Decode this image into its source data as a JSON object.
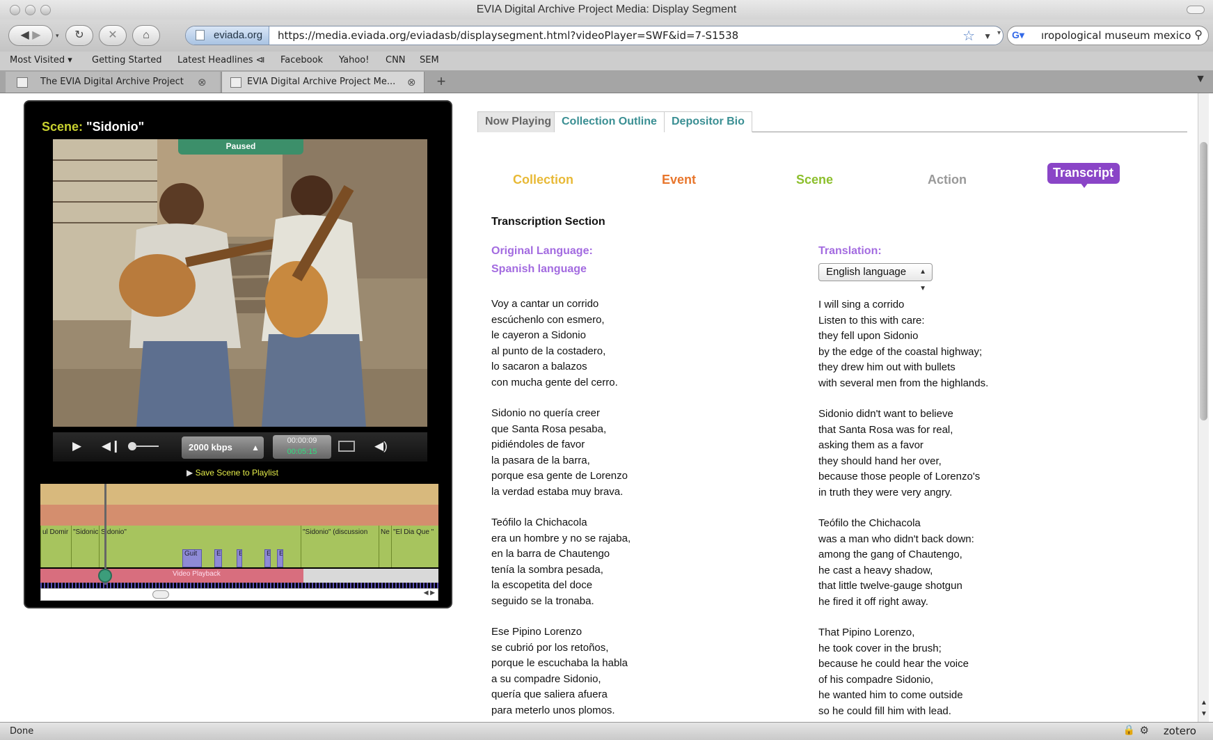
{
  "window": {
    "title": "EVIA Digital Archive Project Media: Display Segment"
  },
  "navbar": {
    "url_domain": "eviada.org",
    "url": "https://media.eviada.org/eviadasb/displaysegment.html?videoPlayer=SWF&id=7-S1538",
    "search_text": "ıropological museum mexico"
  },
  "bookmarks": {
    "items": [
      "Most Visited ▾",
      "Getting Started",
      "Latest Headlines ⧏",
      "Facebook",
      "Yahoo!",
      "CNN",
      "SEM"
    ]
  },
  "tabs": [
    {
      "label": "The EVIA Digital Archive Project",
      "active": false
    },
    {
      "label": "EVIA Digital Archive Project Me...",
      "active": true
    }
  ],
  "player": {
    "scene_key": "Scene:",
    "scene_value": "\"Sidonio\"",
    "state": "Paused",
    "bitrate": "2000 kbps",
    "time_current": "00:00:09",
    "time_total": "00:05:15",
    "volume_level": 0.0,
    "save_scene_label": "Save Scene to Playlist",
    "timeline": {
      "segments": [
        {
          "label": "ul Domir"
        },
        {
          "label": "\"Sidonic"
        },
        {
          "label": "Sidonio\""
        },
        {
          "label": "\"Sidonio\" (discussion"
        },
        {
          "label": "Ne"
        },
        {
          "label": "\"El Dia Que \""
        }
      ],
      "actions": [
        {
          "label": "Guit"
        },
        {
          "label": "E"
        },
        {
          "label": "E"
        },
        {
          "label": "E"
        },
        {
          "label": "E"
        }
      ],
      "playback_label": "Video Playback",
      "playback_progress": 0.66
    }
  },
  "page_tabs": {
    "now_playing": "Now Playing",
    "collection_outline": "Collection Outline",
    "depositor_bio": "Depositor Bio"
  },
  "categories": {
    "collection": "Collection",
    "event": "Event",
    "scene": "Scene",
    "action": "Action",
    "transcript": "Transcript",
    "colors": {
      "collection": "#e8b936",
      "event": "#e8762c",
      "scene": "#8cbf2c",
      "action": "#999999",
      "transcript": "#8a45c7"
    }
  },
  "transcript": {
    "section_title": "Transcription Section",
    "original_label": "Original Language:",
    "original_language": "Spanish language",
    "translation_label": "Translation:",
    "translation_selected": "English language",
    "original": [
      [
        "Voy a cantar un corrido",
        "escúchenlo con esmero,",
        "le cayeron a Sidonio",
        "al punto de la costadero,",
        "lo sacaron a balazos",
        "con mucha gente del cerro."
      ],
      [
        "Sidonio no quería creer",
        "que Santa Rosa pesaba,",
        "pidiéndoles de favor",
        "la pasara de la barra,",
        "porque esa gente de Lorenzo",
        "la verdad estaba muy brava."
      ],
      [
        "Teófilo la Chichacola",
        "era un hombre y no se rajaba,",
        "en la barra de Chautengo",
        "tenía la sombra pesada,",
        "la escopetita del doce",
        "seguido se la tronaba."
      ],
      [
        "Ese Pipino Lorenzo",
        "se cubrió por los retoños,",
        "porque le escuchaba la habla",
        "a su compadre Sidonio,",
        "quería que saliera afuera",
        "para meterlo unos plomos."
      ]
    ],
    "translation": [
      [
        "I will sing a corrido",
        "Listen to this with care:",
        "they fell upon Sidonio",
        "by the edge of the coastal highway;",
        "they drew him out with bullets",
        "with several men from the highlands."
      ],
      [
        "Sidonio didn't want to believe",
        "that Santa Rosa was for real,",
        "asking them as a favor",
        "they should hand her over,",
        "because those people of Lorenzo's",
        "in truth they were very angry."
      ],
      [
        "Teófilo the Chichacola",
        "was a man who didn't back down:",
        "among the gang of Chautengo,",
        "he cast a heavy shadow,",
        "that little twelve-gauge shotgun",
        "he fired it off right away."
      ],
      [
        "That Pipino Lorenzo,",
        "he took cover in the brush;",
        "because he could hear the voice",
        "of his compadre Sidonio,",
        "he wanted him to come outside",
        "so he could fill him with lead."
      ]
    ]
  },
  "statusbar": {
    "text": "Done",
    "addon": "zotero"
  }
}
